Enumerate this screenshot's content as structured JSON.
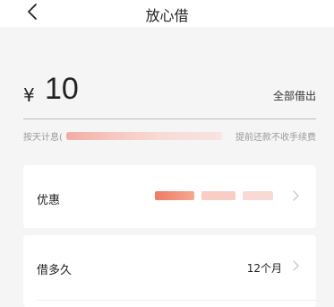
{
  "header": {
    "title": "放心借"
  },
  "amount": {
    "currency": "¥",
    "value": "10",
    "borrow_all_label": "全部借出"
  },
  "interest": {
    "label": "按天计息(",
    "prepay_note": "提前还款不收手续费"
  },
  "rows": [
    {
      "label": "优惠"
    },
    {
      "label": "借多久",
      "value": "12个月"
    }
  ],
  "colors": {
    "background": "#f5f5f5",
    "card": "#ffffff",
    "divider": "#bdbdbd",
    "muted_text": "#999999",
    "blur_accent": "#f07a63"
  },
  "icons": {
    "back": "chevron-left-icon",
    "row_chevron": "chevron-right-icon"
  }
}
